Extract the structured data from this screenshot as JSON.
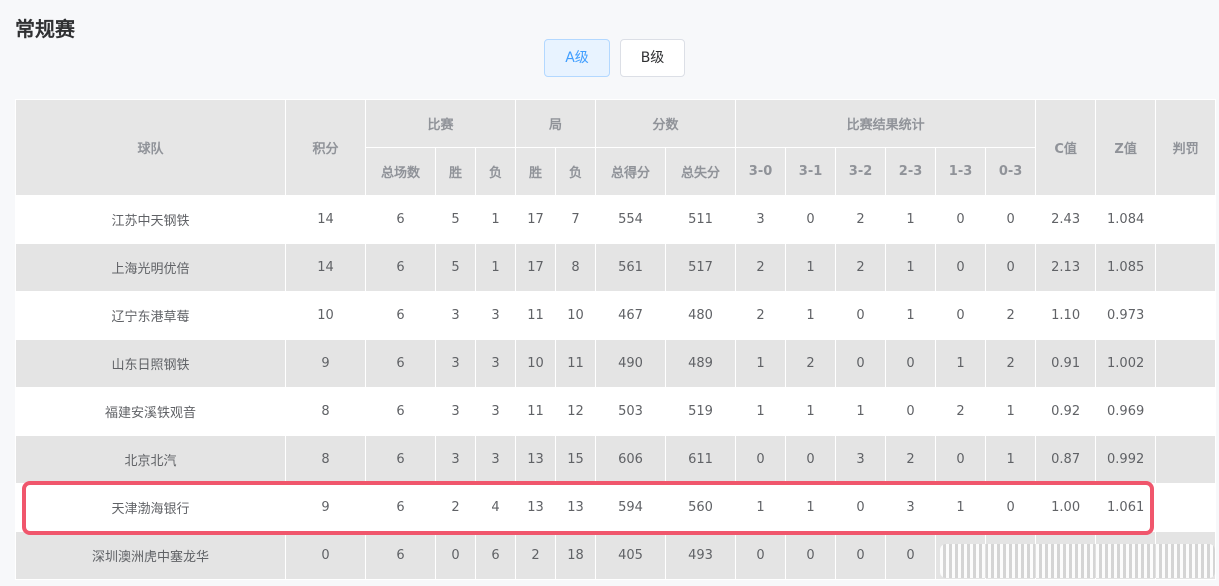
{
  "page": {
    "title": "常规赛"
  },
  "tabs": [
    {
      "label": "A级",
      "active": true
    },
    {
      "label": "B级",
      "active": false
    }
  ],
  "table": {
    "groups": {
      "team": "球队",
      "points": "积分",
      "match": "比赛",
      "set": "局",
      "score": "分数",
      "result": "比赛结果统计",
      "c": "C值",
      "z": "Z值",
      "penalty": "判罚"
    },
    "subheaders": [
      "总场数",
      "胜",
      "负",
      "胜",
      "负",
      "总得分",
      "总失分",
      "3-0",
      "3-1",
      "3-2",
      "2-3",
      "1-3",
      "0-3"
    ],
    "rows": [
      [
        "江苏中天钢铁",
        "14",
        "6",
        "5",
        "1",
        "17",
        "7",
        "554",
        "511",
        "3",
        "0",
        "2",
        "1",
        "0",
        "0",
        "2.43",
        "1.084",
        ""
      ],
      [
        "上海光明优倍",
        "14",
        "6",
        "5",
        "1",
        "17",
        "8",
        "561",
        "517",
        "2",
        "1",
        "2",
        "1",
        "0",
        "0",
        "2.13",
        "1.085",
        ""
      ],
      [
        "辽宁东港草莓",
        "10",
        "6",
        "3",
        "3",
        "11",
        "10",
        "467",
        "480",
        "2",
        "1",
        "0",
        "1",
        "0",
        "2",
        "1.10",
        "0.973",
        ""
      ],
      [
        "山东日照钢铁",
        "9",
        "6",
        "3",
        "3",
        "10",
        "11",
        "490",
        "489",
        "1",
        "2",
        "0",
        "0",
        "1",
        "2",
        "0.91",
        "1.002",
        ""
      ],
      [
        "福建安溪铁观音",
        "8",
        "6",
        "3",
        "3",
        "11",
        "12",
        "503",
        "519",
        "1",
        "1",
        "1",
        "0",
        "2",
        "1",
        "0.92",
        "0.969",
        ""
      ],
      [
        "北京北汽",
        "8",
        "6",
        "3",
        "3",
        "13",
        "15",
        "606",
        "611",
        "0",
        "0",
        "3",
        "2",
        "0",
        "1",
        "0.87",
        "0.992",
        ""
      ],
      [
        "天津渤海银行",
        "9",
        "6",
        "2",
        "4",
        "13",
        "13",
        "594",
        "560",
        "1",
        "1",
        "0",
        "3",
        "1",
        "0",
        "1.00",
        "1.061",
        ""
      ],
      [
        "深圳澳洲虎中塞龙华",
        "0",
        "6",
        "0",
        "6",
        "2",
        "18",
        "405",
        "493",
        "0",
        "0",
        "0",
        "0",
        "",
        "",
        "",
        "",
        ""
      ]
    ],
    "highlight_row": 6
  }
}
